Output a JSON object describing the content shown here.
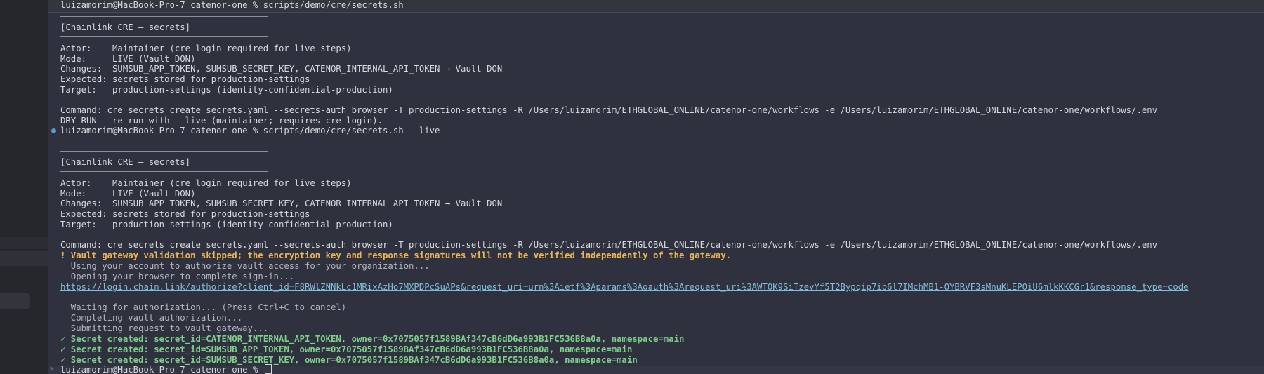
{
  "terminal": {
    "prompt1": "luizamorim@MacBook-Pro-7 catenor-one % scripts/demo/cre/secrets.sh",
    "block1": {
      "header": "[Chainlink CRE – secrets]",
      "actor": "Actor:    Maintainer (cre login required for live steps)",
      "mode": "Mode:     LIVE (Vault DON)",
      "changes": "Changes:  SUMSUB_APP_TOKEN, SUMSUB_SECRET_KEY, CATENOR_INTERNAL_API_TOKEN → Vault DON",
      "expected": "Expected: secrets stored for production-settings",
      "target": "Target:   production-settings (identity-confidential-production)",
      "command": "Command: cre secrets create secrets.yaml --secrets-auth browser -T production-settings -R /Users/luizamorim/ETHGLOBAL_ONLINE/catenor-one/workflows -e /Users/luizamorim/ETHGLOBAL_ONLINE/catenor-one/workflows/.env",
      "dry_run": "DRY RUN – re-run with --live (maintainer; requires cre login)."
    },
    "prompt2": "luizamorim@MacBook-Pro-7 catenor-one % scripts/demo/cre/secrets.sh --live",
    "block2": {
      "header": "[Chainlink CRE – secrets]",
      "actor": "Actor:    Maintainer (cre login required for live steps)",
      "mode": "Mode:     LIVE (Vault DON)",
      "changes": "Changes:  SUMSUB_APP_TOKEN, SUMSUB_SECRET_KEY, CATENOR_INTERNAL_API_TOKEN → Vault DON",
      "expected": "Expected: secrets stored for production-settings",
      "target": "Target:   production-settings (identity-confidential-production)",
      "command": "Command: cre secrets create secrets.yaml --secrets-auth browser -T production-settings -R /Users/luizamorim/ETHGLOBAL_ONLINE/catenor-one/workflows -e /Users/luizamorim/ETHGLOBAL_ONLINE/catenor-one/workflows/.env",
      "warning": "! Vault gateway validation skipped; the encryption key and response signatures will not be verified independently of the gateway.",
      "using_account": "  Using your account to authorize vault access for your organization...",
      "opening_browser": "  Opening your browser to complete sign-in...",
      "auth_url": "https://login.chain.link/authorize?client_id=F8RWlZNNkLc1MRixAzHo7MXPDPcSuAPs&request_uri=urn%3Aietf%3Aparams%3Aoauth%3Arequest_uri%3AWTOK9SiTzevYf5T2Bypqip7ib6l7IMchMB1-OYBRVF3sMnuKLEPOiU6mlkKKCGr1&response_type=code",
      "waiting": "  Waiting for authorization... (Press Ctrl+C to cancel)",
      "completing": "  Completing vault authorization...",
      "submitting": "  Submitting request to vault gateway...",
      "created1": "✓ Secret created: secret_id=CATENOR_INTERNAL_API_TOKEN, owner=0x7075057f1589BAf347cB6dD6a993B1FC536B8a0a, namespace=main",
      "created2": "✓ Secret created: secret_id=SUMSUB_APP_TOKEN, owner=0x7075057f1589BAf347cB6dD6a993B1FC536B8a0a, namespace=main",
      "created3": "✓ Secret created: secret_id=SUMSUB_SECRET_KEY, owner=0x7075057f1589BAf347cB6dD6a993B1FC536B8a0a, namespace=main"
    },
    "prompt3": "luizamorim@MacBook-Pro-7 catenor-one % ",
    "colors": {
      "background": "#2f313e",
      "text": "#d7d9df",
      "warning": "#e9b65a",
      "success": "#7fcf8c",
      "link": "#7fbfd7"
    }
  }
}
